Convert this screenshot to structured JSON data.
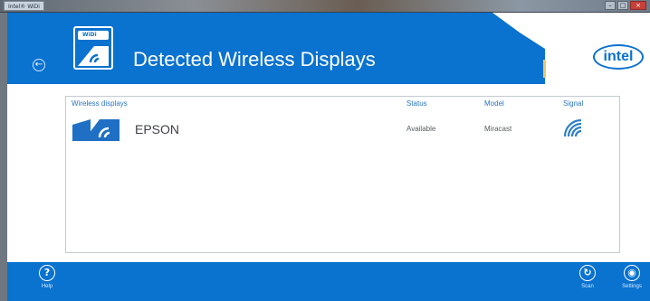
{
  "window": {
    "title": "Intel® WiDi",
    "controls": [
      "–",
      "□",
      "×"
    ]
  },
  "header": {
    "title": "Detected Wireless Displays",
    "back_icon": "back-arrow-icon",
    "logo_text": "intel",
    "widi_badge": "WiDi",
    "accent_color": "#0a72cf"
  },
  "table": {
    "columns": [
      "Wireless displays",
      "Status",
      "Model",
      "Signal"
    ],
    "rows": [
      {
        "name": "EPSON",
        "status": "Available",
        "model": "Miracast",
        "signal_icon": "signal-strength-icon"
      }
    ]
  },
  "bottombar": {
    "help_label": "Help",
    "scan_label": "Scan",
    "settings_label": "Settings"
  }
}
